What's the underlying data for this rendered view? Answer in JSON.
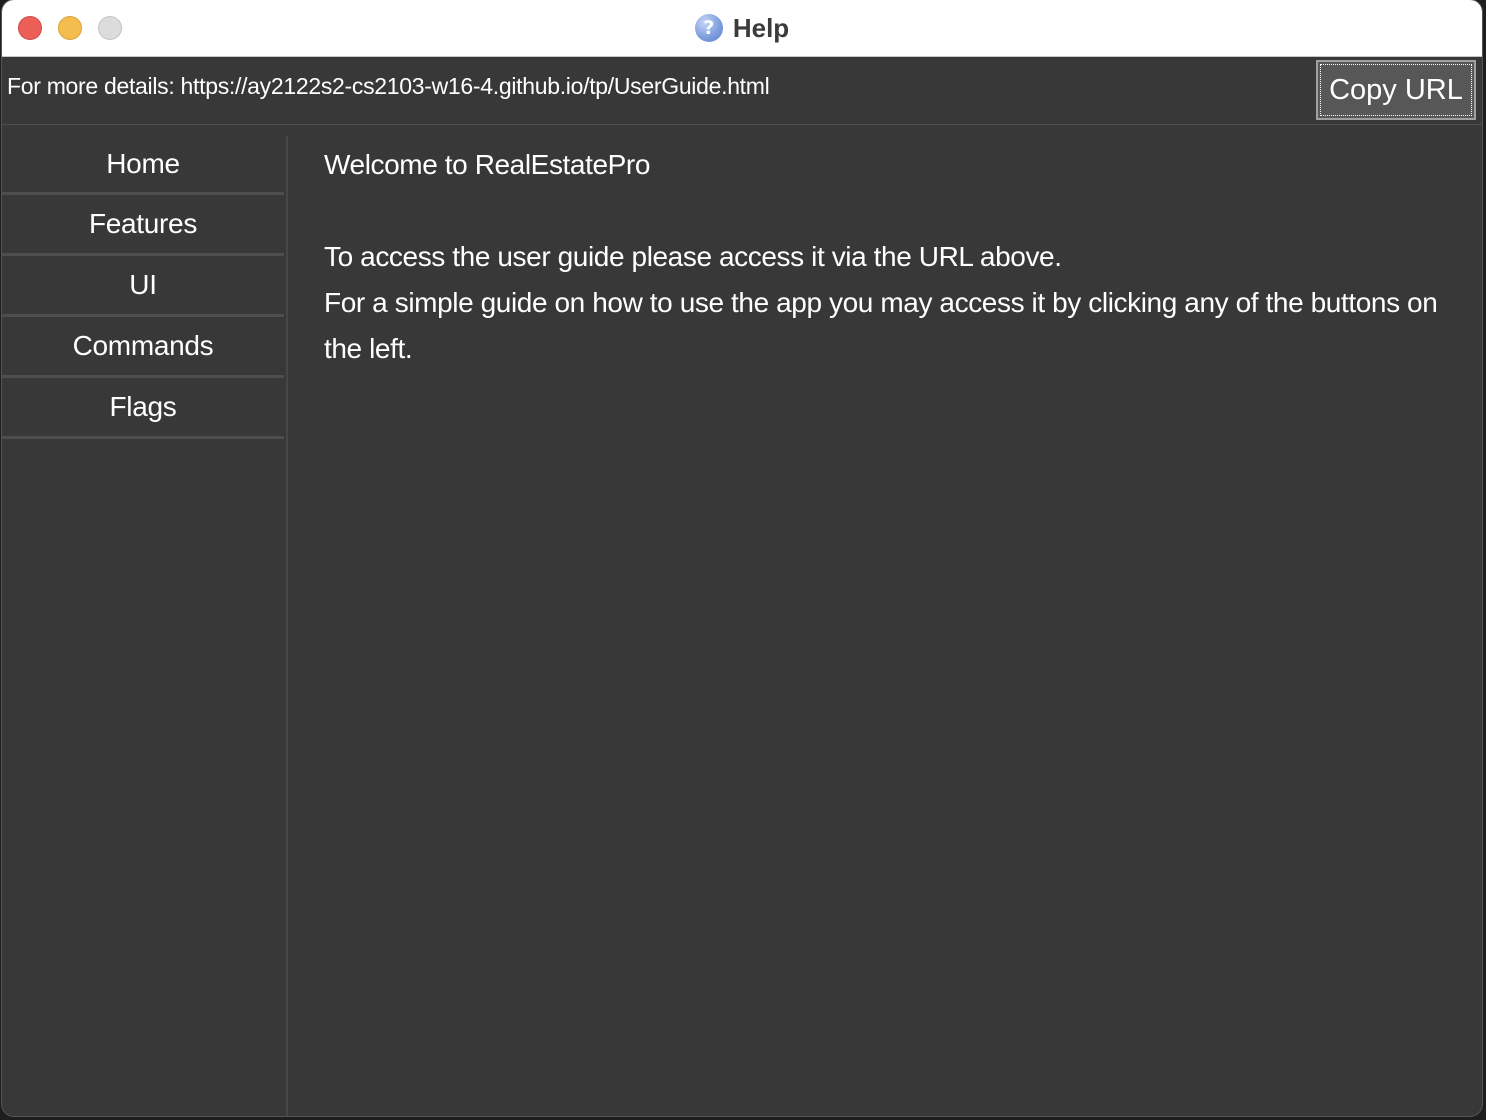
{
  "window": {
    "title": "Help",
    "title_icon": "help-question-icon"
  },
  "urlbar": {
    "text": "For more details: https://ay2122s2-cs2103-w16-4.github.io/tp/UserGuide.html",
    "copy_label": "Copy URL"
  },
  "sidebar": {
    "items": [
      {
        "label": "Home"
      },
      {
        "label": "Features"
      },
      {
        "label": "UI"
      },
      {
        "label": "Commands"
      },
      {
        "label": "Flags"
      }
    ]
  },
  "content": {
    "welcome": "Welcome to RealEstatePro",
    "line1": "To access the user guide please access it via the URL above.",
    "line2": "For a simple guide on how to use the app you may access it by clicking any of the buttons on the left."
  },
  "colors": {
    "background": "#383838",
    "close": "#ec5f59",
    "minimize": "#f4be4f",
    "zoom": "#dcdcdc",
    "button": "#575757"
  }
}
